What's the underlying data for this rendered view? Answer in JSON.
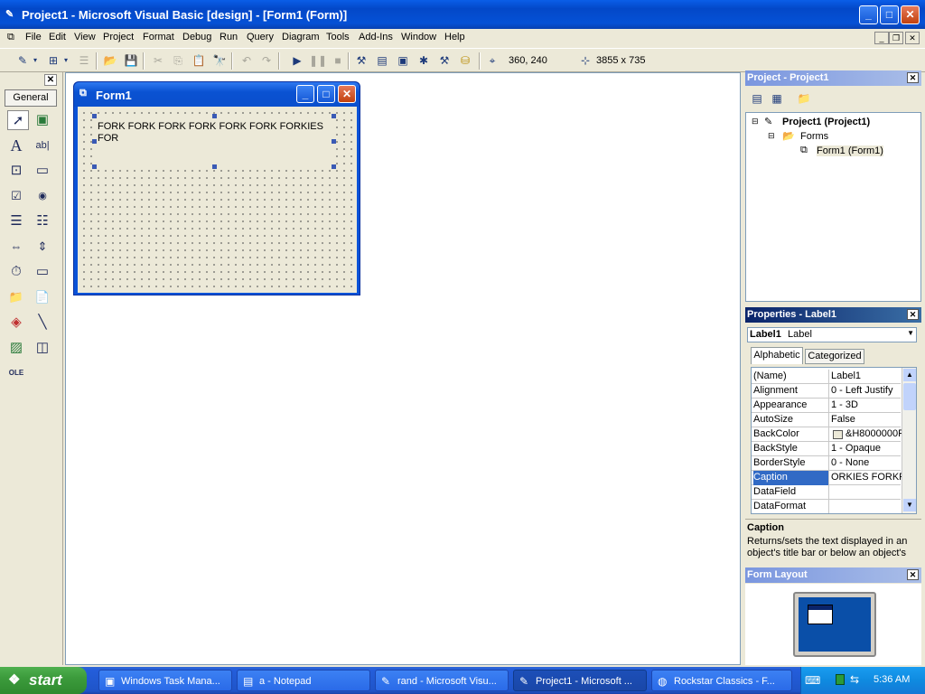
{
  "window": {
    "title": "Project1 - Microsoft Visual Basic [design] - [Form1 (Form)]",
    "minimize": "_",
    "maximize": "□",
    "close": "✕"
  },
  "menubar": {
    "items": [
      "File",
      "Edit",
      "View",
      "Project",
      "Format",
      "Debug",
      "Run",
      "Query",
      "Diagram",
      "Tools",
      "Add-Ins",
      "Window",
      "Help"
    ],
    "mdi_minimize": "_",
    "mdi_restore": "❐",
    "mdi_close": "✕"
  },
  "toolbar": {
    "position": "360, 240",
    "size": "3855 x 735"
  },
  "toolbox": {
    "title": "General",
    "close": "✕",
    "tools": [
      {
        "name": "pointer",
        "glyph": "➚"
      },
      {
        "name": "picturebox",
        "glyph": "▣"
      },
      {
        "name": "label",
        "glyph": "A"
      },
      {
        "name": "textbox",
        "glyph": "ab|"
      },
      {
        "name": "frame",
        "glyph": "⊡"
      },
      {
        "name": "commandbutton",
        "glyph": "▭"
      },
      {
        "name": "checkbox",
        "glyph": "☑"
      },
      {
        "name": "optionbutton",
        "glyph": "◉"
      },
      {
        "name": "combobox",
        "glyph": "☰"
      },
      {
        "name": "listbox",
        "glyph": "☷"
      },
      {
        "name": "hscrollbar",
        "glyph": "⇔"
      },
      {
        "name": "vscrollbar",
        "glyph": "⇕"
      },
      {
        "name": "timer",
        "glyph": "⏱"
      },
      {
        "name": "drivelistbox",
        "glyph": "▭"
      },
      {
        "name": "dirlistbox",
        "glyph": "📁"
      },
      {
        "name": "filelistbox",
        "glyph": "📄"
      },
      {
        "name": "shape",
        "glyph": "◈"
      },
      {
        "name": "line",
        "glyph": "╲"
      },
      {
        "name": "image",
        "glyph": "▨"
      },
      {
        "name": "data",
        "glyph": "◫"
      },
      {
        "name": "ole",
        "glyph": "OLE"
      }
    ]
  },
  "form": {
    "title": "Form1",
    "label_caption": "FORK FORK FORK FORK FORK FORK FORKIES FOR"
  },
  "project_panel": {
    "title": "Project - Project1",
    "tree": {
      "root": "Project1 (Project1)",
      "folder": "Forms",
      "item": "Form1 (Form1)"
    }
  },
  "properties_panel": {
    "title": "Properties - Label1",
    "object_name": "Label1",
    "object_type": "Label",
    "tabs": [
      "Alphabetic",
      "Categorized"
    ],
    "rows": [
      {
        "name": "(Name)",
        "value": "Label1"
      },
      {
        "name": "Alignment",
        "value": "0 - Left Justify"
      },
      {
        "name": "Appearance",
        "value": "1 - 3D"
      },
      {
        "name": "AutoSize",
        "value": "False"
      },
      {
        "name": "BackColor",
        "value": "&H8000000F"
      },
      {
        "name": "BackStyle",
        "value": "1 - Opaque"
      },
      {
        "name": "BorderStyle",
        "value": "0 - None"
      },
      {
        "name": "Caption",
        "value": "ORKIES FORKF"
      },
      {
        "name": "DataField",
        "value": ""
      },
      {
        "name": "DataFormat",
        "value": ""
      }
    ],
    "desc_title": "Caption",
    "desc_text": "Returns/sets the text displayed in an object's title bar or below an object's"
  },
  "form_layout_panel": {
    "title": "Form Layout"
  },
  "taskbar": {
    "start": "start",
    "tasks": [
      "Windows Task Mana...",
      "a - Notepad",
      "rand - Microsoft Visu...",
      "Project1 - Microsoft ...",
      "Rockstar Classics - F..."
    ],
    "clock": "5:36 AM"
  }
}
